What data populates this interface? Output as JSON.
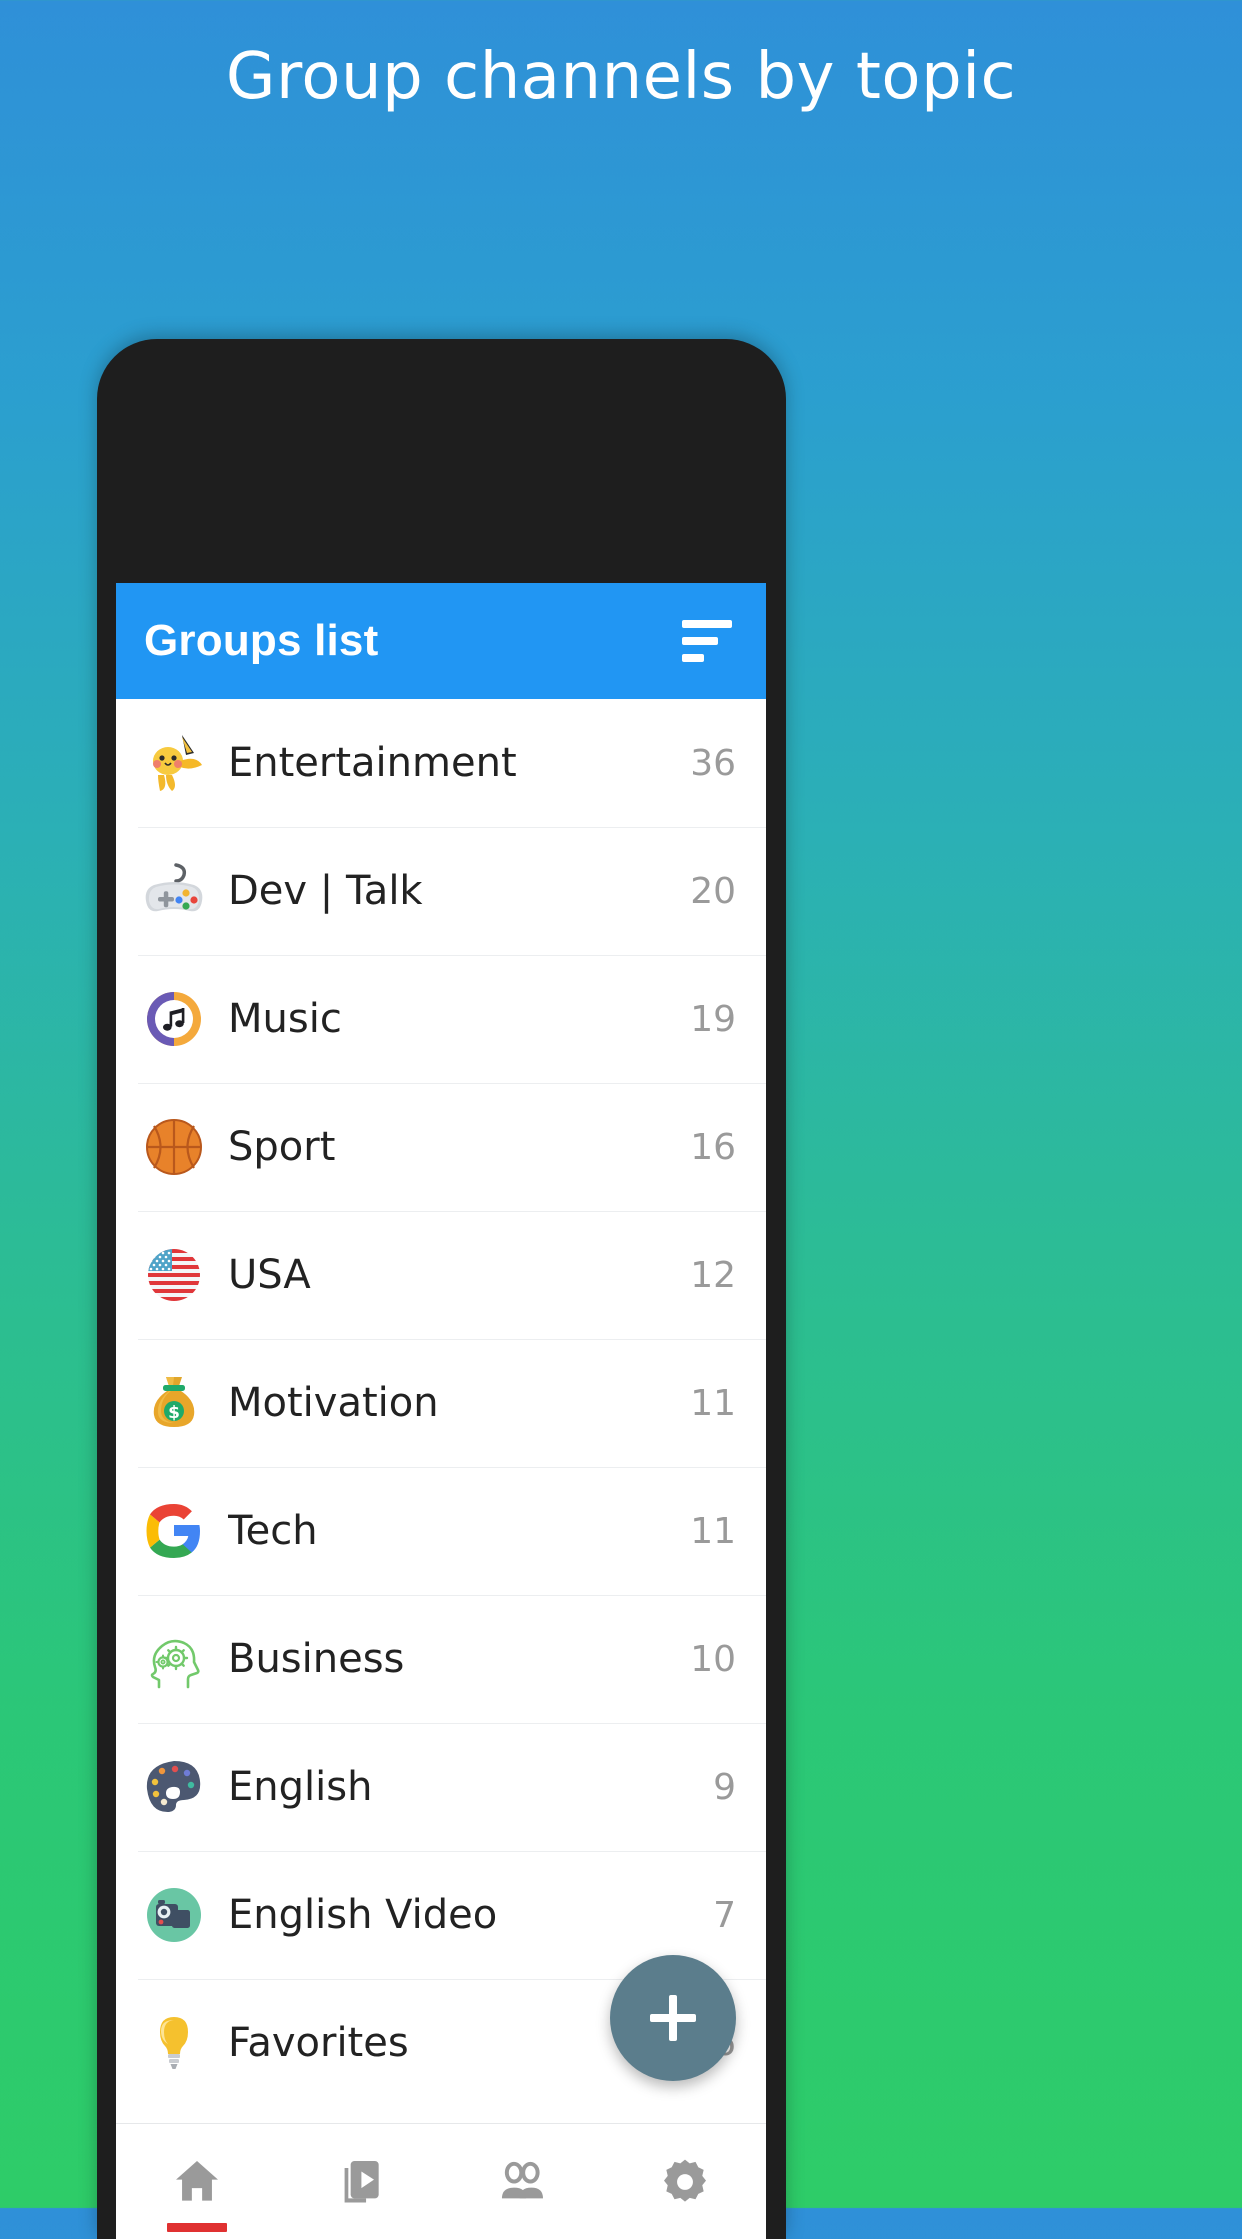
{
  "promo": {
    "headline": "Group channels by topic"
  },
  "colors": {
    "bg_gradient_top": "#2f90d8",
    "bg_gradient_bottom": "#2ecc68",
    "appbar": "#2196f3",
    "fab": "#5b7d8c",
    "active_indicator": "#e03131",
    "count_text": "#9a9a9a",
    "phone_frame": "#1e1e1e"
  },
  "appbar": {
    "title": "Groups list",
    "sort_icon": "sort-icon"
  },
  "groups": [
    {
      "label": "Entertainment",
      "count": "36",
      "icon": "pikachu-icon"
    },
    {
      "label": "Dev | Talk",
      "count": "20",
      "icon": "game-controller-icon"
    },
    {
      "label": "Music",
      "count": "19",
      "icon": "music-note-icon"
    },
    {
      "label": "Sport",
      "count": "16",
      "icon": "basketball-icon"
    },
    {
      "label": "USA",
      "count": "12",
      "icon": "usa-flag-icon"
    },
    {
      "label": "Motivation",
      "count": "11",
      "icon": "money-bag-icon"
    },
    {
      "label": "Tech",
      "count": "11",
      "icon": "google-g-icon"
    },
    {
      "label": "Business",
      "count": "10",
      "icon": "head-gears-icon"
    },
    {
      "label": "English",
      "count": "9",
      "icon": "artist-palette-icon"
    },
    {
      "label": "English Video",
      "count": "7",
      "icon": "video-camera-icon"
    },
    {
      "label": "Favorites",
      "count": "6",
      "icon": "light-bulb-icon"
    }
  ],
  "fab": {
    "label": "+",
    "name": "add-group-button"
  },
  "bottom_nav": {
    "items": [
      {
        "icon": "home-icon",
        "active": true
      },
      {
        "icon": "video-icon",
        "active": false
      },
      {
        "icon": "people-icon",
        "active": false
      },
      {
        "icon": "gear-icon",
        "active": false
      }
    ]
  }
}
